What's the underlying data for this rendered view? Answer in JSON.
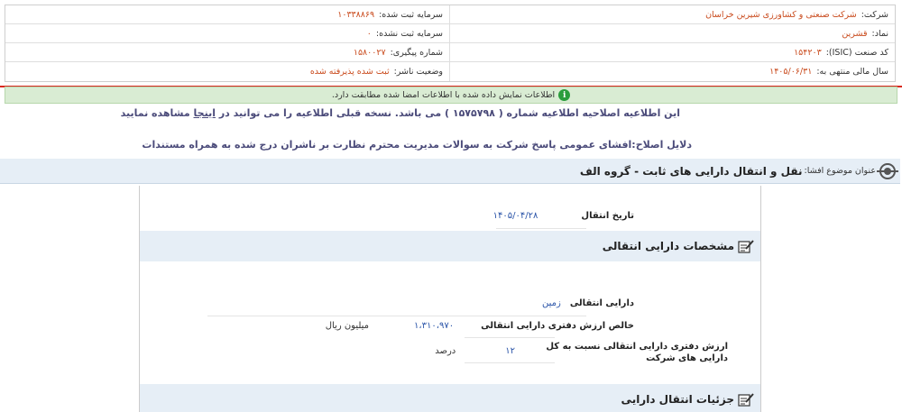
{
  "company": {
    "company_label": "شرکت:",
    "company_value": "شرکت صنعتی و کشاورزی شیرین خراسان",
    "registered_capital_label": "سرمایه ثبت شده:",
    "registered_capital_value": "۱۰۳۳۸۸۶۹",
    "symbol_label": "نماد:",
    "symbol_value": "قشرین",
    "unregistered_capital_label": "سرمایه ثبت نشده:",
    "unregistered_capital_value": "۰",
    "isic_label": "کد صنعت (ISIC):",
    "isic_value": "۱۵۴۲۰۳",
    "tracking_label": "شماره پیگیری:",
    "tracking_value": "۱۵۸۰۰۲۷",
    "fiscal_year_label": "سال مالی منتهی به:",
    "fiscal_year_value": "۱۴۰۵/۰۶/۳۱",
    "publisher_status_label": "وضعیت ناشر:",
    "publisher_status_value": "ثبت شده پذیرفته شده"
  },
  "notice": {
    "text": "اطلاعات نمایش داده شده با اطلاعات امضا شده مطابقت دارد."
  },
  "correction": {
    "text_before": "این اطلاعیه اصلاحیه اطلاعیه شماره ( ۱۵۷۵۷۹۸ ) می باشد. نسخه قبلی اطلاعیه را می توانید در",
    "link": "اینجا",
    "text_after": "مشاهده نمایید",
    "reason": "دلایل اصلاح:افشای عمومی پاسخ شرکت به سوالات مدیریت محترم نظارت بر ناشران درج شده به همراه مستندات"
  },
  "subject": {
    "label": "عنوان موضوع افشا:",
    "value": "نقل و انتقال دارایی های ثابت - گروه الف"
  },
  "transfer": {
    "date_label": "تاریخ انتقال",
    "date_value": "۱۴۰۵/۰۴/۲۸"
  },
  "asset_spec": {
    "title": "مشخصات دارایی انتقالی",
    "asset_label": "دارایی انتقالی",
    "asset_value": "زمین",
    "net_book_label": "خالص ارزش دفتری دارایی انتقالی",
    "net_book_value": "۱،۳۱۰،۹۷۰",
    "net_book_unit": "میلیون ریال",
    "ratio_label": "ارزش دفتری دارایی انتقالی نسبت به کل دارایی های شرکت",
    "ratio_value": "۱۲",
    "ratio_unit": "درصد"
  },
  "transfer_details": {
    "title": "جزئیات انتقال دارایی"
  },
  "colors": {
    "accent_value": "#c94a1c",
    "field_value": "#2a54a8",
    "heading_text": "#4b4b7a",
    "notice_bg": "#d9ecd3",
    "divider_red": "#d9281e"
  }
}
